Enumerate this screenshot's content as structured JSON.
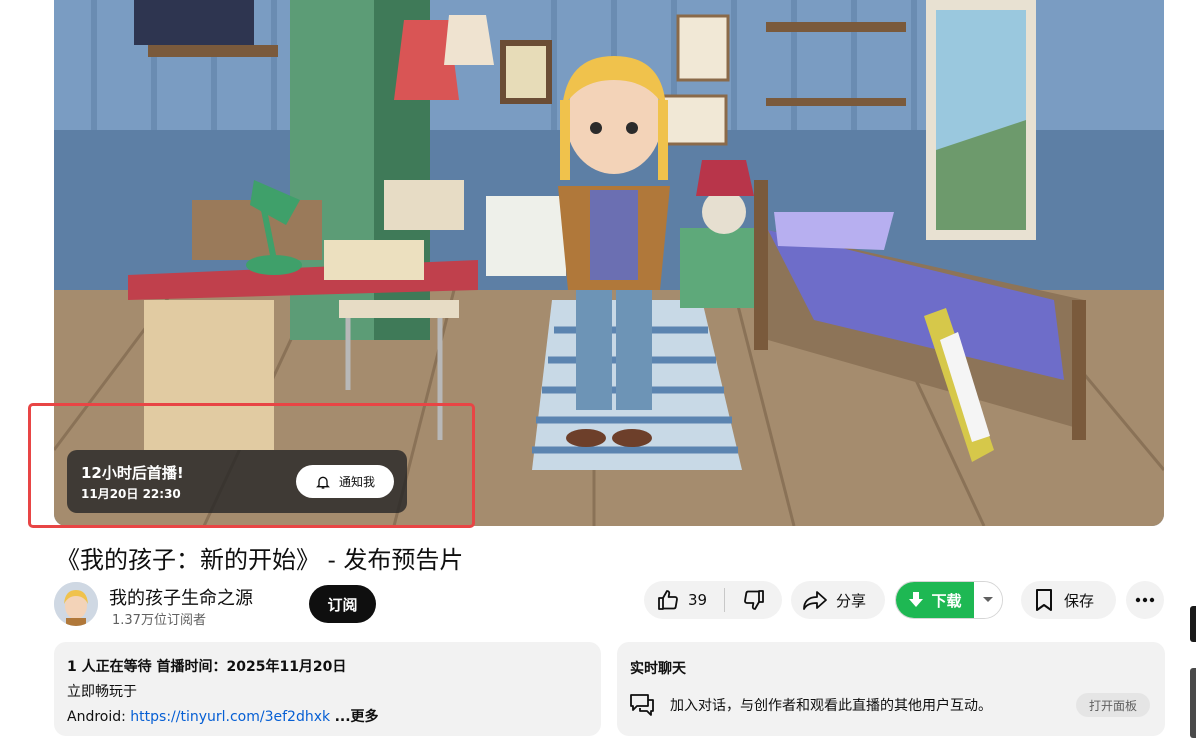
{
  "player": {
    "premiere_countdown": "12小时后首播!",
    "premiere_datetime": "11月20日 22:30",
    "notify_label": "通知我"
  },
  "video": {
    "title": "《我的孩子：新的开始》 - 发布预告片"
  },
  "channel": {
    "name": "我的孩子生命之源",
    "subscribers": "1.37万位订阅者",
    "subscribe_label": "订阅"
  },
  "actions": {
    "like_count": "39",
    "share_label": "分享",
    "download_label": "下载",
    "save_label": "保存"
  },
  "description": {
    "meta": "1 人正在等待  首播时间：2025年11月20日",
    "line1": "立即畅玩于",
    "line2_prefix": "Android: ",
    "line2_link": "https://tinyurl.com/3ef2dhxk",
    "more_label": "...更多"
  },
  "live_chat": {
    "title": "实时聊天",
    "prompt": "加入对话，与创作者和观看此直播的其他用户互动。",
    "open_panel_label": "打开面板"
  },
  "colors": {
    "subscribe_bg": "#0f0f0f",
    "download_bg": "#1eb853",
    "highlight_border": "#e84545",
    "link": "#065fd4",
    "panel_bg": "#f2f2f2"
  }
}
